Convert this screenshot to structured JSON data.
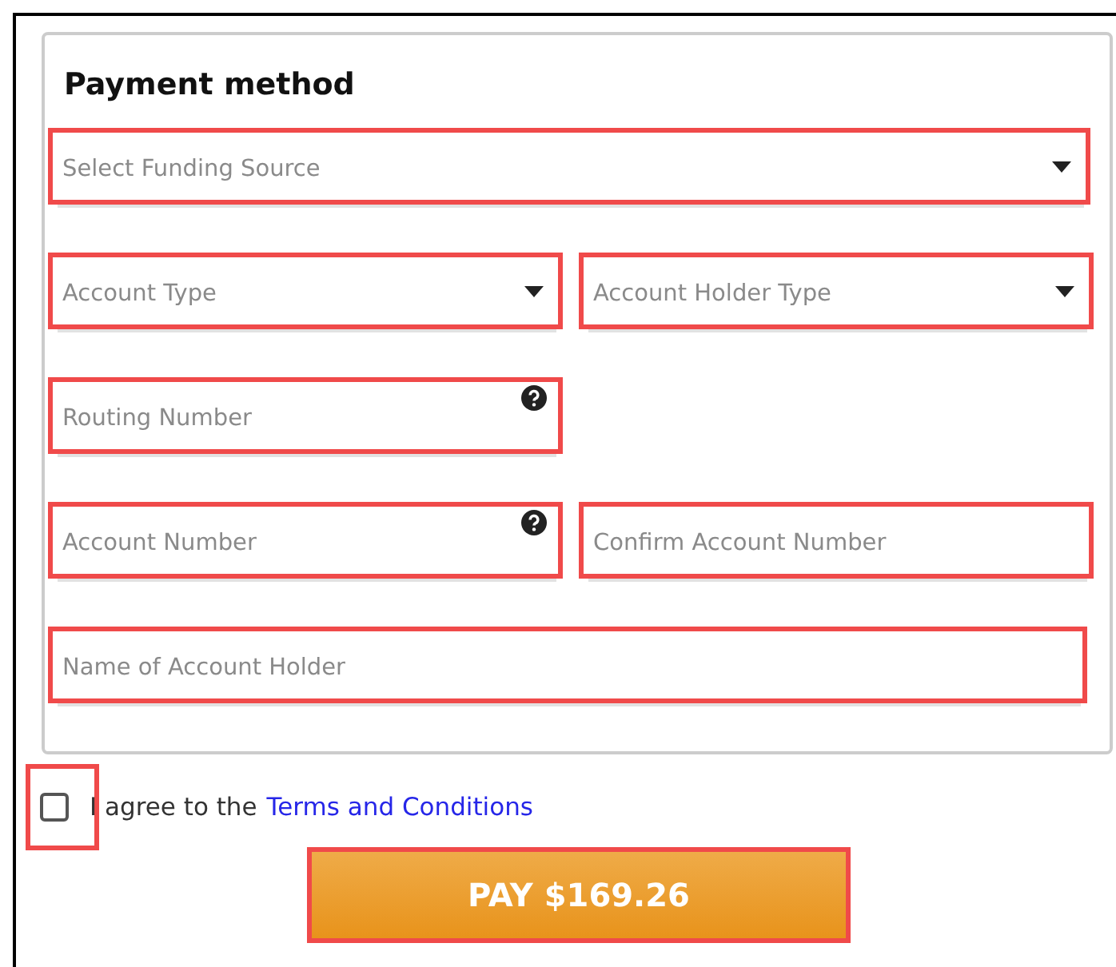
{
  "payment_method": {
    "title": "Payment method",
    "rows": [
      [
        {
          "kind": "select",
          "placeholder": "Select Funding Source",
          "help": false
        }
      ],
      [
        {
          "kind": "select",
          "placeholder": "Account Type",
          "help": false
        },
        {
          "kind": "select",
          "placeholder": "Account Holder Type",
          "help": false
        }
      ],
      [
        {
          "kind": "text",
          "placeholder": "Routing Number",
          "help": true
        }
      ],
      [
        {
          "kind": "text",
          "placeholder": "Account Number",
          "help": true
        },
        {
          "kind": "text",
          "placeholder": "Confirm Account Number",
          "help": false
        }
      ],
      [
        {
          "kind": "text",
          "placeholder": "Name of Account Holder",
          "help": false
        }
      ]
    ]
  },
  "agreement": {
    "checked": false,
    "text": "I agree to the",
    "link": "Terms and Conditions"
  },
  "pay_button": {
    "label": "PAY $169.26"
  }
}
